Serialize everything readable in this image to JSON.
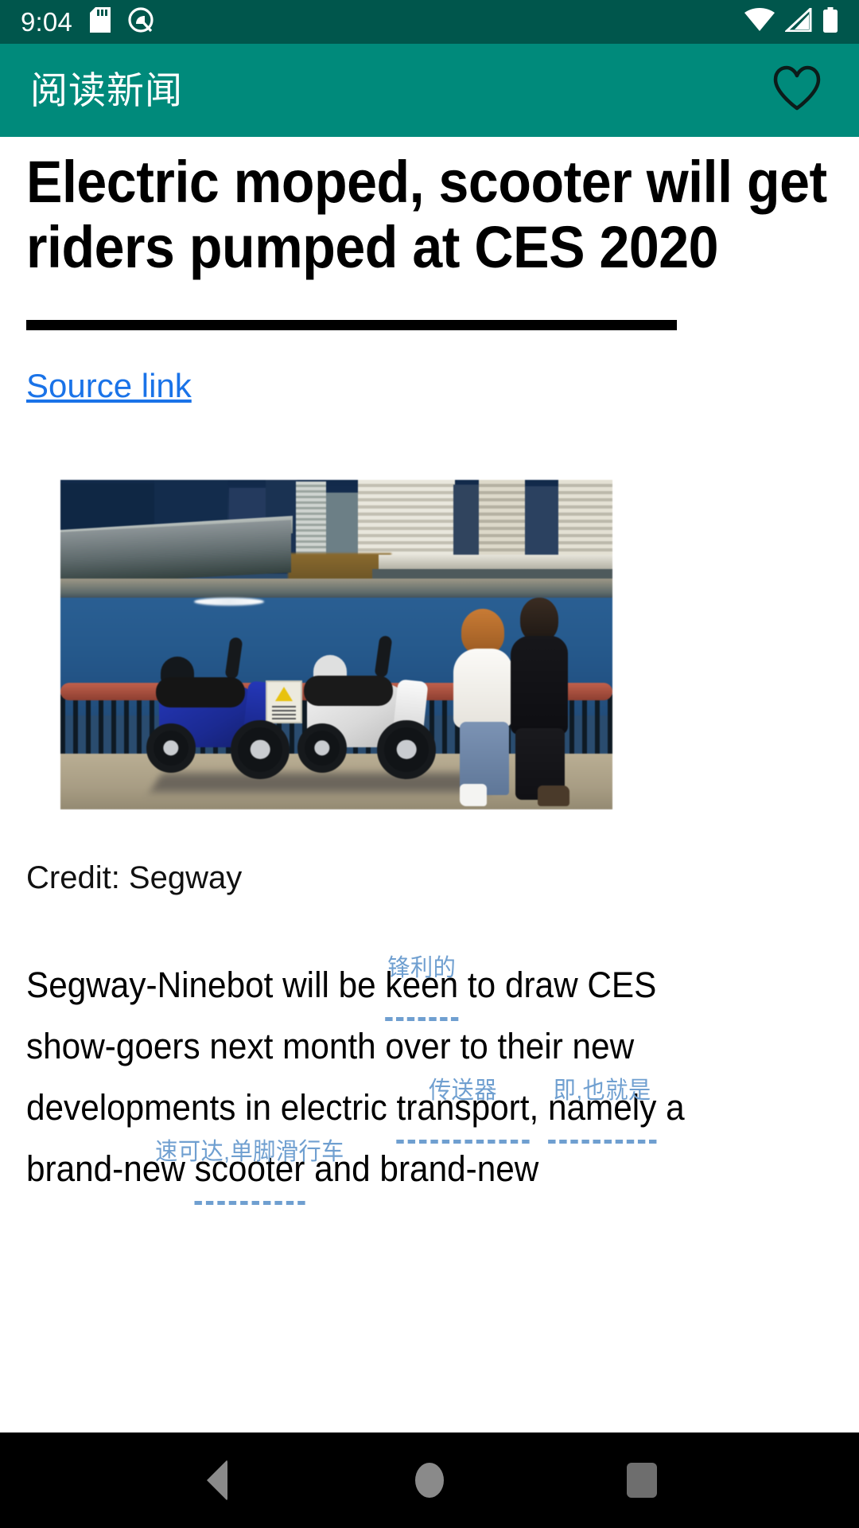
{
  "status_bar": {
    "time": "9:04",
    "icons_left": [
      "sd-card-icon",
      "android-q-icon"
    ],
    "icons_right": [
      "wifi-icon",
      "cellular-signal-icon",
      "battery-icon"
    ],
    "background_color": "#00564c"
  },
  "app_bar": {
    "title": "阅读新闻",
    "favorite_icon": "heart-outline-icon",
    "background_color": "#008a7b",
    "title_color": "#ffffff"
  },
  "article": {
    "headline": "Electric moped, scooter will get riders pumped at CES 2020",
    "source_link_label": "Source link",
    "source_link_color": "#1a73e8",
    "image_credit": "Credit: Segway",
    "figure_alt": "Two electric scooters parked by a waterfront railing with a couple standing nearby",
    "body_lines": [
      {
        "segments": [
          {
            "text": "Segway-Ninebot will be "
          },
          {
            "text": "keen",
            "annotation": "锋利的"
          },
          {
            "text": " to draw CES"
          }
        ]
      },
      {
        "segments": [
          {
            "text": "show-goers next month over to their new"
          }
        ]
      },
      {
        "segments": [
          {
            "text": "developments in electric "
          },
          {
            "text": "transport",
            "annotation": "传送器"
          },
          {
            "text": ", "
          },
          {
            "text": "namely",
            "annotation": "即,也就是"
          },
          {
            "text": " a"
          }
        ]
      },
      {
        "segments": [
          {
            "text": "brand-new "
          },
          {
            "text": "scooter",
            "annotation": "速可达,单脚滑行车"
          },
          {
            "text": " and brand-new"
          }
        ]
      }
    ],
    "annotation_color": "#6f9fd0"
  },
  "nav_bar": {
    "background_color": "#000000",
    "buttons": [
      {
        "name": "back-button",
        "icon": "triangle-back-icon"
      },
      {
        "name": "home-button",
        "icon": "circle-home-icon"
      },
      {
        "name": "recents-button",
        "icon": "square-recents-icon"
      }
    ]
  }
}
